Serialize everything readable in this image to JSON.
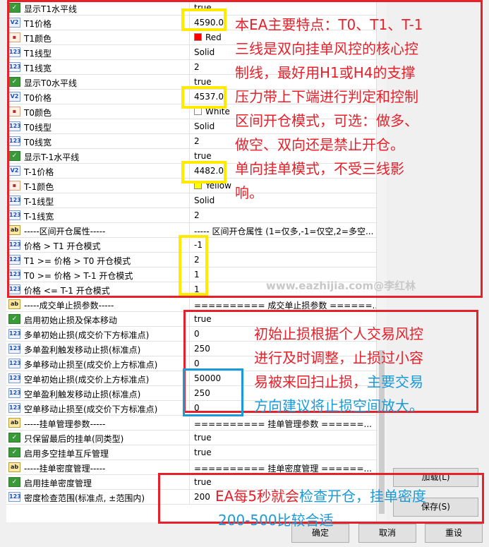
{
  "rows": [
    {
      "icon": "bool",
      "name": "显示T1水平线",
      "value": "true"
    },
    {
      "icon": "dbl",
      "name": "T1价格",
      "value": "4590.0"
    },
    {
      "icon": "color",
      "name": "T1颜色",
      "value": "Red",
      "swatch": "#ff0000"
    },
    {
      "icon": "int",
      "name": "T1线型",
      "value": "Solid"
    },
    {
      "icon": "int",
      "name": "T1线宽",
      "value": "2"
    },
    {
      "icon": "bool",
      "name": "显示T0水平线",
      "value": "true"
    },
    {
      "icon": "dbl",
      "name": "T0价格",
      "value": "4537.0"
    },
    {
      "icon": "color",
      "name": "T0颜色",
      "value": "White",
      "swatch": "#ffffff"
    },
    {
      "icon": "int",
      "name": "T0线型",
      "value": "Solid"
    },
    {
      "icon": "int",
      "name": "T0线宽",
      "value": "2"
    },
    {
      "icon": "bool",
      "name": "显示T-1水平线",
      "value": "true"
    },
    {
      "icon": "dbl",
      "name": "T-1价格",
      "value": "4482.0"
    },
    {
      "icon": "color",
      "name": "T-1颜色",
      "value": "Yellow",
      "swatch": "#ffff00"
    },
    {
      "icon": "int",
      "name": "T-1线型",
      "value": "Solid"
    },
    {
      "icon": "int",
      "name": "T-1线宽",
      "value": "2"
    },
    {
      "icon": "str",
      "name": "-----区间开仓属性-----",
      "value": "----- 区间开仓属性 (1=仅多,-1=仅空,2=多空..."
    },
    {
      "icon": "int",
      "name": "价格 > T1 开仓模式",
      "value": "-1"
    },
    {
      "icon": "int",
      "name": "T1 >= 价格 > T0 开仓模式",
      "value": "2"
    },
    {
      "icon": "int",
      "name": "T0 >= 价格 > T-1 开仓模式",
      "value": "1"
    },
    {
      "icon": "int",
      "name": "价格 <= T-1 开仓模式",
      "value": "1"
    },
    {
      "icon": "str",
      "name": "-----成交单止损参数-----",
      "value": "========== 成交单止损参数 ======..."
    },
    {
      "icon": "bool",
      "name": "启用初始止损及保本移动",
      "value": "true"
    },
    {
      "icon": "int",
      "name": "多单初始止损(成交价下方标准点)",
      "value": "0"
    },
    {
      "icon": "int",
      "name": "多单盈利触发移动止损(标准点)",
      "value": "250"
    },
    {
      "icon": "int",
      "name": "多单移动止损至(成交价上方标准点)",
      "value": "0"
    },
    {
      "icon": "int",
      "name": "空单初始止损(成交价上方标准点)",
      "value": "50000"
    },
    {
      "icon": "int",
      "name": "空单盈利触发移动止损(标准点)",
      "value": "250"
    },
    {
      "icon": "int",
      "name": "空单移动止损至(成交价下方标准点)",
      "value": "0"
    },
    {
      "icon": "str",
      "name": "-----挂单管理参数-----",
      "value": "========== 挂单管理参数 ======..."
    },
    {
      "icon": "bool",
      "name": "只保留最后的挂单(同类型)",
      "value": "true"
    },
    {
      "icon": "bool",
      "name": "启用多空挂单互斥管理",
      "value": "true"
    },
    {
      "icon": "str",
      "name": "-----挂单密度管理-----",
      "value": "========== 挂单密度管理 ======..."
    },
    {
      "icon": "bool",
      "name": "启用挂单密度管理",
      "value": "true"
    },
    {
      "icon": "int",
      "name": "密度检查范围(标准点, ±范围内)",
      "value": "200"
    }
  ],
  "icons": {
    "bool": "✓",
    "int": "123",
    "dbl": "V2",
    "color": "▪",
    "str": "ab"
  },
  "buttons": {
    "load": "加载(L)",
    "save": "保存(S)",
    "ok": "确定",
    "cancel": "取消",
    "reset": "重设"
  },
  "notes": {
    "note1": [
      "本EA主要特点：T0、T1、T-1",
      "三线是双向挂单风控的核心控",
      "制线，最好用H1或H4的支撑",
      "压力带上下端进行判定和控制",
      "区间开仓模式，可选：做多、",
      "做空、双向还是禁止开仓。",
      "单向挂单模式，不受三线影",
      "响。"
    ],
    "note2_red": [
      "初始止损根据个人交易风控",
      "进行及时调整，止损过小容",
      "易被来回扫止损，"
    ],
    "note2_blue_tail": "主要交易",
    "note2_blue_last": "方向建议将止损空间放大。",
    "note3_red": "EA每5秒就会",
    "note3_blue": "检查开仓，挂单密度",
    "note3_blue_last": "200-500比较合适"
  },
  "watermark": "www.eazhijia.com@李红林",
  "colors": {
    "annotation_red": "#e8202a",
    "highlight_yellow": "#ffea00",
    "annotation_blue": "#1a9ad8"
  }
}
